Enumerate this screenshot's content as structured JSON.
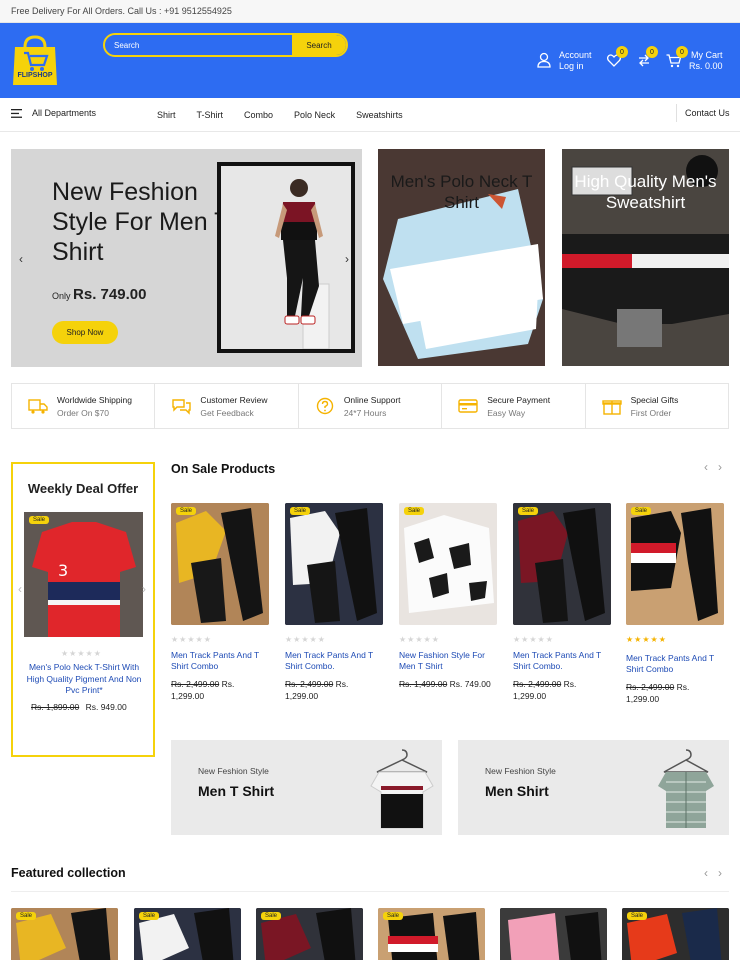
{
  "topbar": {
    "text": "Free Delivery For All Orders. Call Us : +91 9512554925"
  },
  "header": {
    "logo_text": "FLIPSHOP",
    "search": {
      "placeholder": "Search",
      "button": "Search"
    },
    "account": {
      "line1": "Account",
      "line2": "Log in"
    },
    "wishlist_count": "0",
    "compare_count": "0",
    "cart": {
      "count": "0",
      "line1": "My Cart",
      "line2": "Rs. 0.00"
    }
  },
  "nav": {
    "departments": "All Departments",
    "items": [
      "Shirt",
      "T-Shirt",
      "Combo",
      "Polo Neck",
      "Sweatshirts"
    ],
    "contact": "Contact Us"
  },
  "hero": {
    "title": "New Feshion Style For Men T Shirt",
    "price_prefix": "Only",
    "price": "Rs. 749.00",
    "button": "Shop Now"
  },
  "promos": [
    {
      "title": "Men's Polo Neck T Shirt",
      "color": "#1a1a1a"
    },
    {
      "title": "High Quality Men's Sweatshirt",
      "color": "#ffffff"
    }
  ],
  "features": [
    {
      "icon": "truck-icon",
      "title": "Worldwide Shipping",
      "subtitle": "Order On $70"
    },
    {
      "icon": "chat-icon",
      "title": "Customer Review",
      "subtitle": "Get Feedback"
    },
    {
      "icon": "help-icon",
      "title": "Online Support",
      "subtitle": "24*7 Hours"
    },
    {
      "icon": "card-icon",
      "title": "Secure Payment",
      "subtitle": "Easy Way"
    },
    {
      "icon": "gift-icon",
      "title": "Special Gifts",
      "subtitle": "First Order"
    }
  ],
  "weekly": {
    "title": "Weekly Deal Offer",
    "sale": "Sale",
    "stars": "★★★★★",
    "name": "Men's Polo Neck T-Shirt With High Quality Pigment And Non Pvc Print*",
    "old_price": "Rs. 1,899.00",
    "price": "Rs. 949.00"
  },
  "on_sale": {
    "title": "On Sale Products",
    "arrows": "‹›",
    "products": [
      {
        "sale": "Sale",
        "stars": "★★★★★",
        "rated": false,
        "name": "Men Track Pants And T Shirt Combo",
        "old_price": "Rs. 2,499.00",
        "price": "Rs. 1,299.00"
      },
      {
        "sale": "Sale",
        "stars": "★★★★★",
        "rated": false,
        "name": "Men Track Pants And T Shirt Combo.",
        "old_price": "Rs. 2,499.00",
        "price": "Rs. 1,299.00"
      },
      {
        "sale": "Sale",
        "stars": "★★★★★",
        "rated": false,
        "name": "New Fashion Style For Men T Shirt",
        "old_price": "Rs. 1,499.00",
        "price": "Rs. 749.00"
      },
      {
        "sale": "Sale",
        "stars": "★★★★★",
        "rated": false,
        "name": "Men Track Pants And T Shirt Combo.",
        "old_price": "Rs. 2,499.00",
        "price": "Rs. 1,299.00"
      },
      {
        "sale": "Sale",
        "stars": "★★★★★",
        "rated": true,
        "name": "Men Track Pants And T Shirt Combo",
        "old_price": "Rs. 2,499.00",
        "price": "Rs. 1,299.00"
      }
    ]
  },
  "banners": [
    {
      "subtitle": "New Feshion Style",
      "title": "Men T Shirt"
    },
    {
      "subtitle": "New Feshion Style",
      "title": "Men Shirt"
    }
  ],
  "featured": {
    "title": "Featured collection",
    "arrows": "‹›",
    "sale": "Sale"
  },
  "colors": {
    "brand_blue": "#2d6cf2",
    "accent_yellow": "#f5d20b",
    "link_blue": "#1e4bb5"
  }
}
